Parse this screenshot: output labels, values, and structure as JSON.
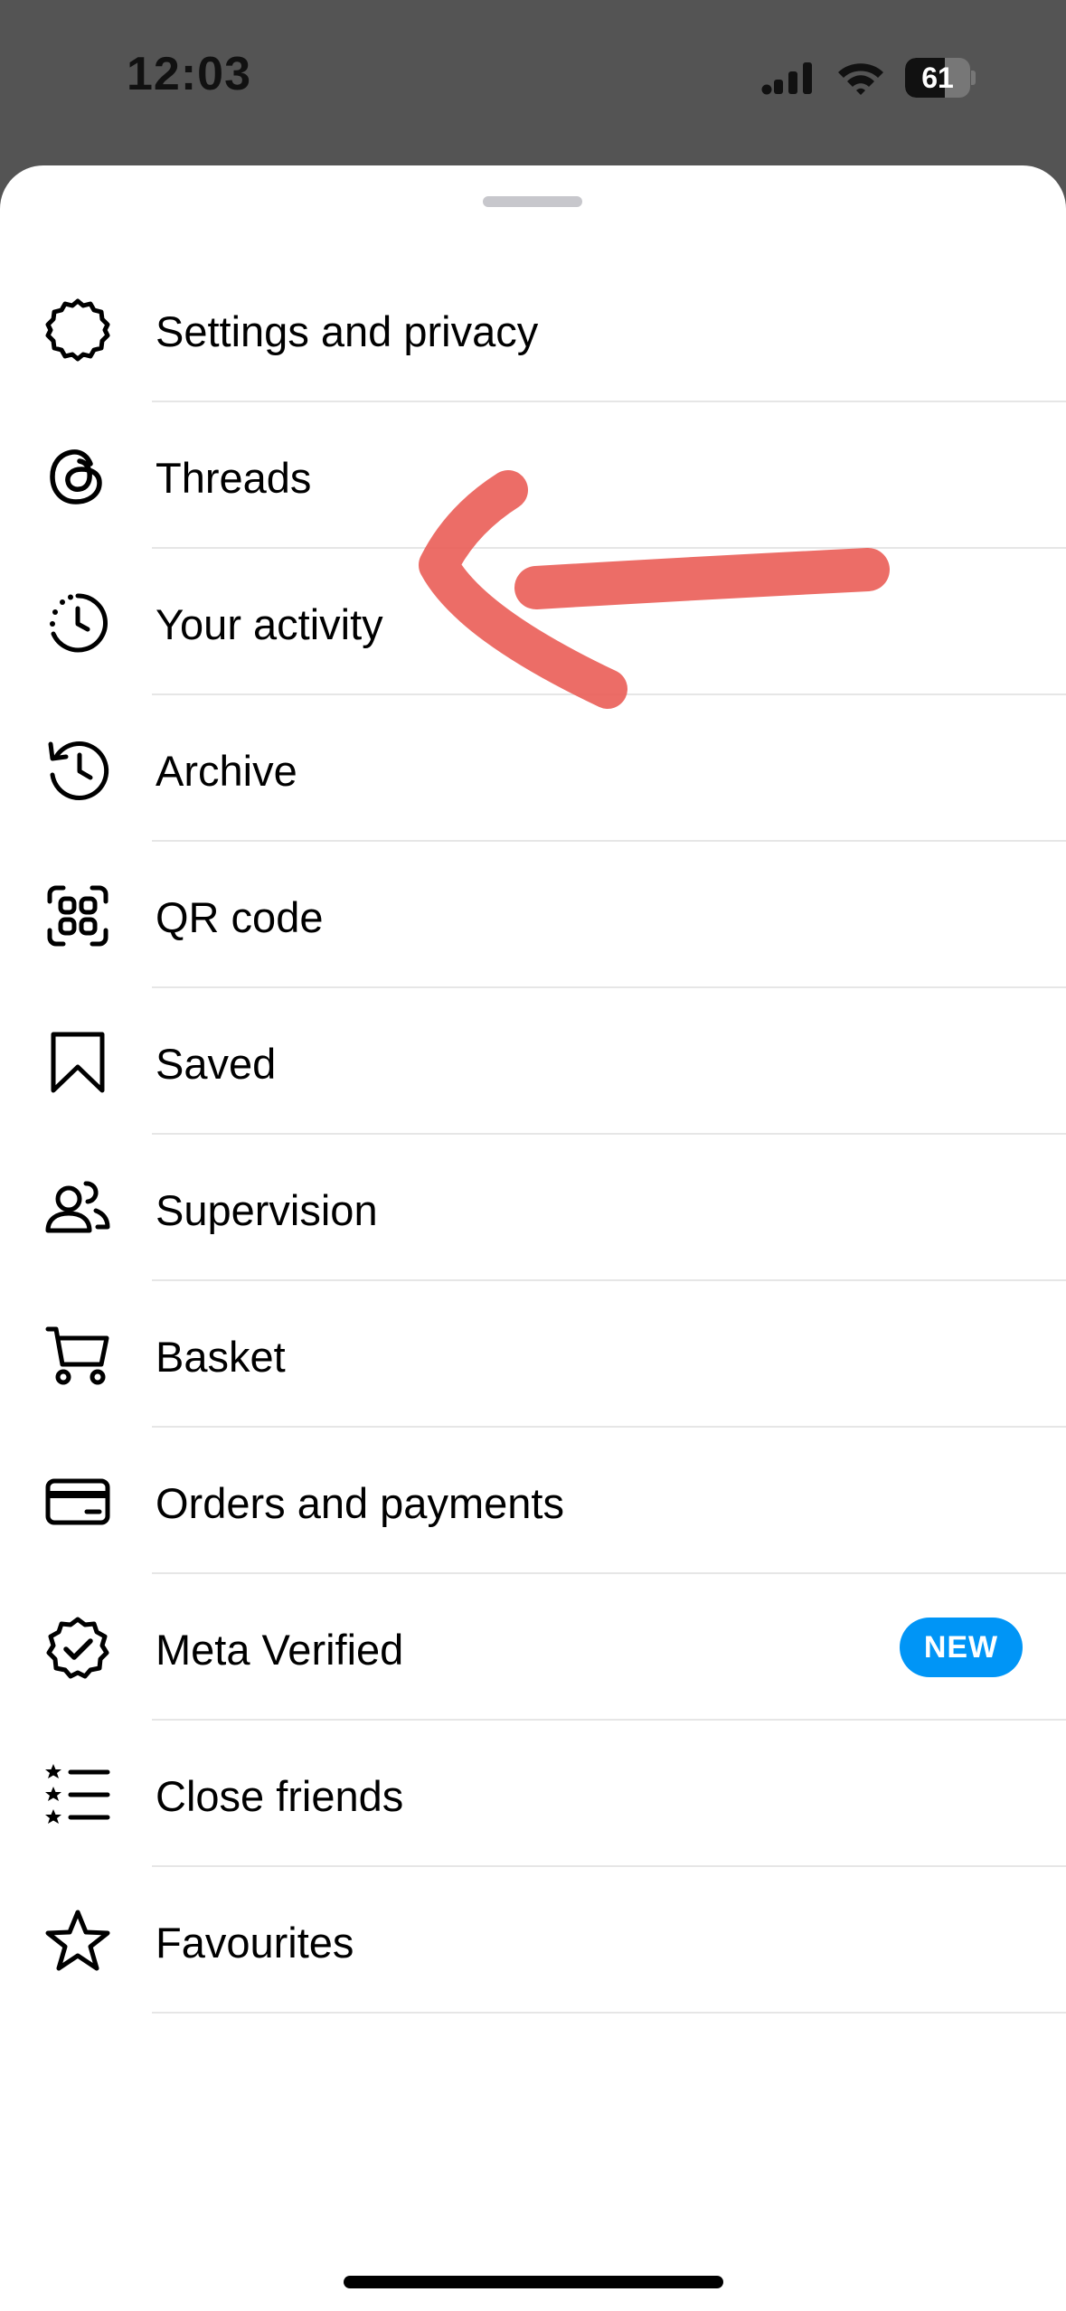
{
  "status_bar": {
    "time": "12:03",
    "battery_level": "61",
    "battery_fraction": 0.61
  },
  "menu": {
    "items": [
      {
        "label": "Settings and privacy",
        "icon": "settings-icon"
      },
      {
        "label": "Threads",
        "icon": "threads-icon"
      },
      {
        "label": "Your activity",
        "icon": "activity-icon"
      },
      {
        "label": "Archive",
        "icon": "archive-icon"
      },
      {
        "label": "QR code",
        "icon": "qr-code-icon"
      },
      {
        "label": "Saved",
        "icon": "bookmark-icon"
      },
      {
        "label": "Supervision",
        "icon": "supervision-icon"
      },
      {
        "label": "Basket",
        "icon": "basket-icon"
      },
      {
        "label": "Orders and payments",
        "icon": "card-icon"
      },
      {
        "label": "Meta Verified",
        "icon": "verified-badge-icon",
        "badge": "NEW"
      },
      {
        "label": "Close friends",
        "icon": "close-friends-icon"
      },
      {
        "label": "Favourites",
        "icon": "star-icon"
      }
    ]
  },
  "colors": {
    "badge": "#0095f6",
    "annotation": "#ea5d56",
    "overlay": "#545454"
  }
}
